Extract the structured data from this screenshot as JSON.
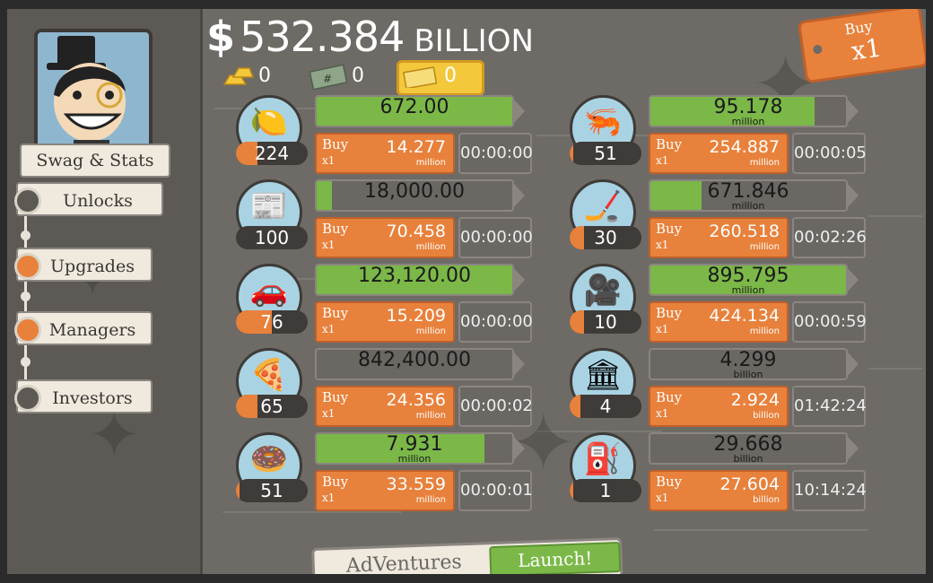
{
  "header": {
    "currency_symbol": "$",
    "money": "532.384",
    "money_unit": "BILLION",
    "gold_count": "0",
    "megabucks_count": "0",
    "ticket_count": "0"
  },
  "buy_multiplier": {
    "buy_label": "Buy",
    "multiplier_label": "x1"
  },
  "sidebar": {
    "swag_label": "Swag & Stats",
    "items": [
      {
        "label": "Unlocks"
      },
      {
        "label": "Upgrades"
      },
      {
        "label": "Managers"
      },
      {
        "label": "Investors"
      }
    ]
  },
  "businesses": [
    {
      "icon": "lemon-icon",
      "glyph": "🍋",
      "owned": "224",
      "owned_progress": 0.3,
      "revenue": "672.00",
      "revenue_unit": "",
      "progress": 1.0,
      "buy_label": "Buy",
      "buy_mult": "x1",
      "price": "14.277",
      "price_unit": "million",
      "timer": "00:00:00"
    },
    {
      "icon": "newspaper-icon",
      "glyph": "📰",
      "owned": "100",
      "owned_progress": 0.0,
      "revenue": "18,000.00",
      "revenue_unit": "",
      "progress": 0.08,
      "buy_label": "Buy",
      "buy_mult": "x1",
      "price": "70.458",
      "price_unit": "million",
      "timer": "00:00:00"
    },
    {
      "icon": "car-icon",
      "glyph": "🚗",
      "owned": "76",
      "owned_progress": 0.5,
      "revenue": "123,120.00",
      "revenue_unit": "",
      "progress": 1.0,
      "buy_label": "Buy",
      "buy_mult": "x1",
      "price": "15.209",
      "price_unit": "million",
      "timer": "00:00:00"
    },
    {
      "icon": "pizza-icon",
      "glyph": "🍕",
      "owned": "65",
      "owned_progress": 0.3,
      "revenue": "842,400.00",
      "revenue_unit": "",
      "progress": 0.0,
      "buy_label": "Buy",
      "buy_mult": "x1",
      "price": "24.356",
      "price_unit": "million",
      "timer": "00:00:02"
    },
    {
      "icon": "donut-icon",
      "glyph": "🍩",
      "owned": "51",
      "owned_progress": 0.05,
      "revenue": "7.931",
      "revenue_unit": "million",
      "progress": 0.86,
      "buy_label": "Buy",
      "buy_mult": "x1",
      "price": "33.559",
      "price_unit": "million",
      "timer": "00:00:01"
    },
    {
      "icon": "shrimp-icon",
      "glyph": "🦐",
      "owned": "51",
      "owned_progress": 0.05,
      "revenue": "95.178",
      "revenue_unit": "million",
      "progress": 0.84,
      "buy_label": "Buy",
      "buy_mult": "x1",
      "price": "254.887",
      "price_unit": "million",
      "timer": "00:00:05"
    },
    {
      "icon": "hockey-icon",
      "glyph": "🏒",
      "owned": "30",
      "owned_progress": 0.2,
      "revenue": "671.846",
      "revenue_unit": "million",
      "progress": 0.26,
      "buy_label": "Buy",
      "buy_mult": "x1",
      "price": "260.518",
      "price_unit": "million",
      "timer": "00:02:26"
    },
    {
      "icon": "movie-camera-icon",
      "glyph": "🎥",
      "owned": "10",
      "owned_progress": 0.2,
      "revenue": "895.795",
      "revenue_unit": "million",
      "progress": 1.0,
      "buy_label": "Buy",
      "buy_mult": "x1",
      "price": "424.134",
      "price_unit": "million",
      "timer": "00:00:59"
    },
    {
      "icon": "bank-icon",
      "glyph": "🏛",
      "owned": "4",
      "owned_progress": 0.15,
      "revenue": "4.299",
      "revenue_unit": "billion",
      "progress": 0.0,
      "buy_label": "Buy",
      "buy_mult": "x1",
      "price": "2.924",
      "price_unit": "billion",
      "timer": "01:42:24"
    },
    {
      "icon": "oil-rig-icon",
      "glyph": "⛽",
      "owned": "1",
      "owned_progress": 0.05,
      "revenue": "29.668",
      "revenue_unit": "billion",
      "progress": 0.0,
      "buy_label": "Buy",
      "buy_mult": "x1",
      "price": "27.604",
      "price_unit": "billion",
      "timer": "10:14:24"
    }
  ],
  "bottom": {
    "adventures_label": "AdVentures",
    "launch_label": "Launch!"
  }
}
